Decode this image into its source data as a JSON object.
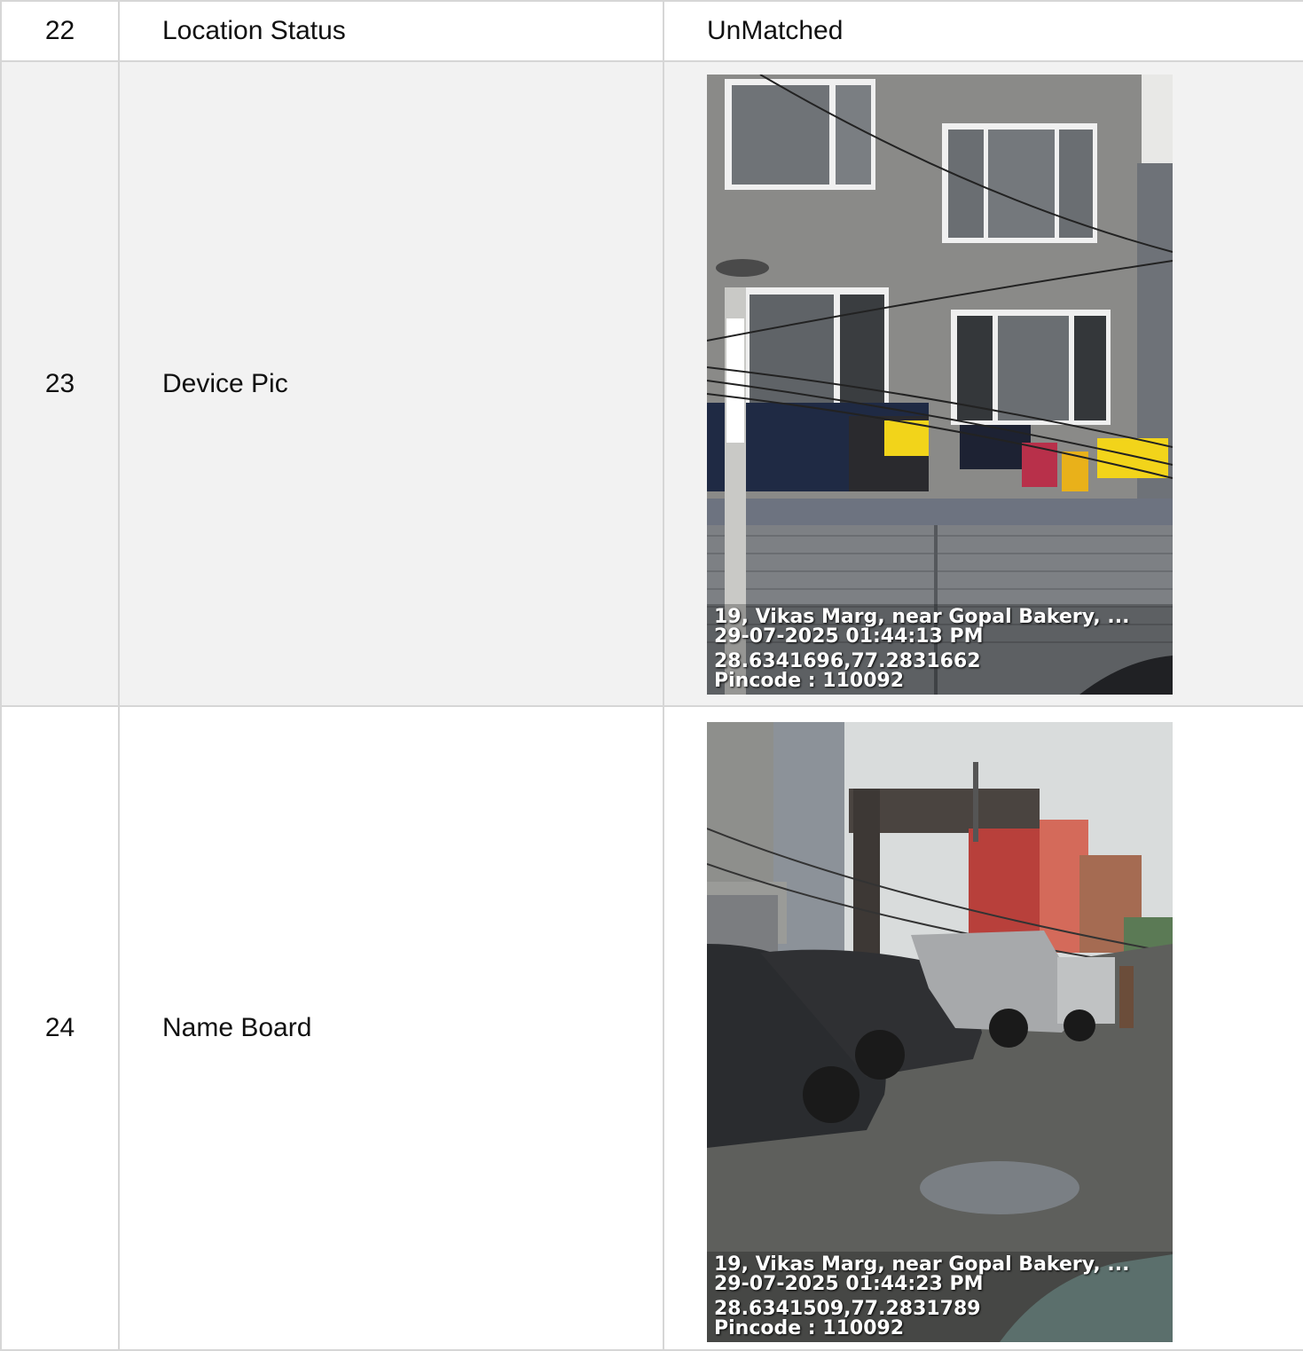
{
  "rows": [
    {
      "num": "22",
      "label": "Location Status",
      "value": "UnMatched"
    },
    {
      "num": "23",
      "label": "Device Pic",
      "photo": {
        "address": "19, Vikas Marg, near Gopal Bakery, ...",
        "datetime": "29-07-2025 01:44:13 PM",
        "coords": "28.6341696,77.2831662",
        "pincode": "Pincode : 110092"
      }
    },
    {
      "num": "24",
      "label": "Name Board",
      "photo": {
        "address": "19, Vikas Marg, near Gopal Bakery, ...",
        "datetime": "29-07-2025 01:44:23 PM",
        "coords": "28.6341509,77.2831789",
        "pincode": "Pincode : 110092"
      }
    }
  ],
  "colors": {
    "border": "#d6d6d6",
    "row_alt": "#f2f2f2",
    "text": "#111111"
  }
}
